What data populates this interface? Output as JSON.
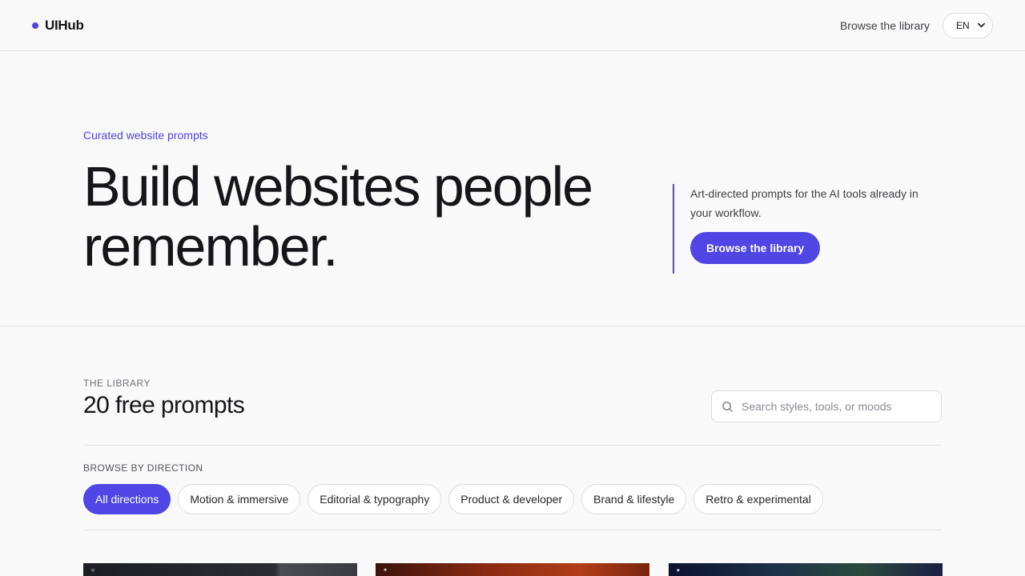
{
  "colors": {
    "accent": "#4f46e5",
    "background": "#f9f9f9",
    "text": "#16161a"
  },
  "header": {
    "brand": "UIHub",
    "browse_link": "Browse the library",
    "language": "EN"
  },
  "hero": {
    "eyebrow": "Curated website prompts",
    "title_line1": "Build websites people",
    "title_line2": "remember.",
    "description": "Art-directed prompts for the AI tools already in your workflow.",
    "cta": "Browse the library"
  },
  "library": {
    "eyebrow": "THE LIBRARY",
    "title": "20 free prompts",
    "search_placeholder": "Search styles, tools, or moods",
    "browse_label": "BROWSE BY DIRECTION",
    "filters": [
      "All directions",
      "Motion & immersive",
      "Editorial & typography",
      "Product & developer",
      "Brand & lifestyle",
      "Retro & experimental"
    ],
    "active_filter": "All directions"
  }
}
